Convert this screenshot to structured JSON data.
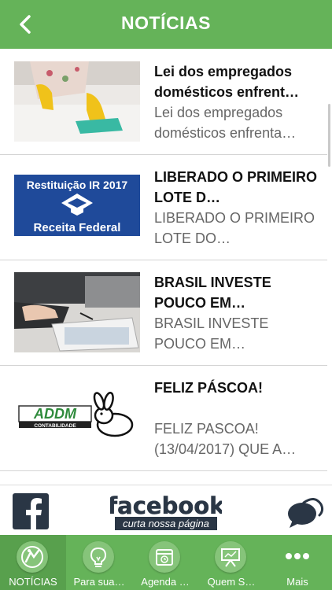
{
  "header": {
    "title": "NOTÍCIAS"
  },
  "news": [
    {
      "title": "Lei dos empregados domésticos enfrent…",
      "preview": "Lei dos empregados domésticos enfrenta…"
    },
    {
      "title": "LIBERADO O PRIMEIRO LOTE D…",
      "preview": "LIBERADO O PRIMEIRO LOTE DO…"
    },
    {
      "title": "BRASIL INVESTE POUCO EM…",
      "preview": "BRASIL INVESTE POUCO EM…"
    },
    {
      "title": "FELIZ PÁSCOA!",
      "preview": "FELIZ PASCOA! (13/04/2017) QUE A…"
    }
  ],
  "thumb2": {
    "line1": "Restituição IR 2017",
    "line2": "Receita Federal"
  },
  "thumb4": {
    "logo": "ADDM",
    "sub": "CONTABILIDADE"
  },
  "facebook": {
    "logo": "facebook",
    "tagline": "curta nossa página"
  },
  "tabs": [
    {
      "label": "NOTÍCIAS",
      "icon": "news-icon"
    },
    {
      "label": "Para sua…",
      "icon": "lightbulb-icon"
    },
    {
      "label": "Agenda …",
      "icon": "calendar-icon"
    },
    {
      "label": "Quem S…",
      "icon": "presentation-icon"
    },
    {
      "label": "Mais",
      "icon": "more-icon"
    }
  ],
  "colors": {
    "primary": "#65b359",
    "active_tab": "#58a04d"
  }
}
